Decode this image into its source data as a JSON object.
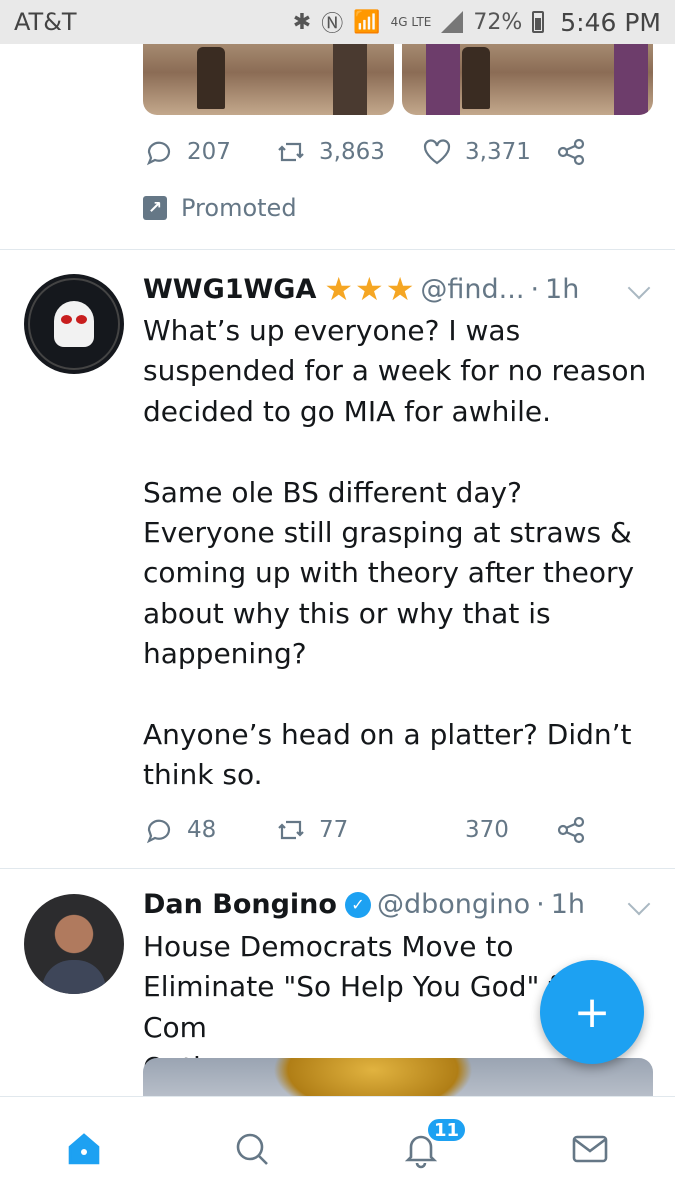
{
  "status_bar": {
    "carrier": "AT&T",
    "network": "4G LTE",
    "battery": "72%",
    "time": "5:46 PM"
  },
  "promoted_tweet": {
    "replies": "207",
    "retweets": "3,863",
    "likes": "3,371",
    "promoted_label": "Promoted"
  },
  "tweets": [
    {
      "name": "WWG1WGA",
      "handle": "@find...",
      "separator": "·",
      "age": "1h",
      "stars": 3,
      "text": "What’s up everyone? I was suspended for a week for no reason decided to go MIA for awhile.\n\nSame ole BS different day? Everyone still grasping at straws & coming up with theory after theory about why this or why that is happening?\n\nAnyone’s head on a platter? Didn’t think so.",
      "replies": "48",
      "retweets": "77",
      "likes": "370"
    },
    {
      "name": "Dan Bongino",
      "verified": true,
      "handle": "@dbongino",
      "separator": "·",
      "age": "1h",
      "text": "House Democrats Move to Eliminate \"So Help You God\" from Com\nOath"
    }
  ],
  "fab": {
    "icon": "compose-tweet-icon",
    "label": "+"
  },
  "bottom_nav": {
    "items": [
      "home-icon",
      "search-icon",
      "notifications-icon",
      "messages-icon"
    ],
    "notifications_badge": "11"
  },
  "colors": {
    "accent": "#1da1f2",
    "muted": "#657786",
    "star": "#f5a623"
  }
}
